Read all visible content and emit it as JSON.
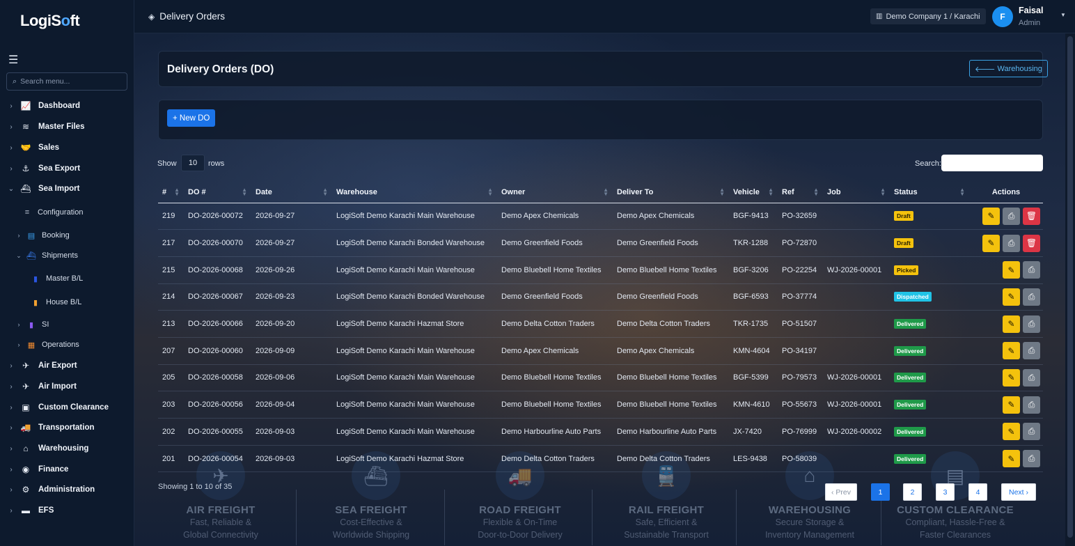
{
  "app": {
    "logo_main": "LogiS",
    "logo_accent": "o",
    "logo_end": "ft"
  },
  "sidebar": {
    "search_placeholder": "Search menu...",
    "items": [
      {
        "label": "Dashboard",
        "icon": "chart-line-icon"
      },
      {
        "label": "Master Files",
        "icon": "database-icon"
      },
      {
        "label": "Sales",
        "icon": "handshake-icon"
      },
      {
        "label": "Sea Export",
        "icon": "anchor-icon"
      },
      {
        "label": "Sea Import",
        "icon": "ship-icon"
      },
      {
        "label": "Air Export",
        "icon": "plane-icon"
      },
      {
        "label": "Air Import",
        "icon": "plane-arrival-icon"
      },
      {
        "label": "Custom Clearance",
        "icon": "customs-icon"
      },
      {
        "label": "Transportation",
        "icon": "truck-icon"
      },
      {
        "label": "Warehousing",
        "icon": "warehouse-icon"
      },
      {
        "label": "Finance",
        "icon": "coins-icon"
      },
      {
        "label": "Administration",
        "icon": "gear-icon"
      },
      {
        "label": "EFS",
        "icon": "folder-icon"
      }
    ],
    "sea_import_children": {
      "configuration": "Configuration",
      "booking": "Booking",
      "shipments": "Shipments",
      "master_bl": "Master B/L",
      "house_bl": "House B/L",
      "si": "SI",
      "operations": "Operations"
    }
  },
  "topbar": {
    "title": "Delivery Orders",
    "company": "Demo Company 1 / Karachi",
    "avatar_initial": "F",
    "user_name": "Faisal",
    "user_role": "Admin"
  },
  "page": {
    "title": "Delivery Orders (DO)",
    "back_button": "Warehousing",
    "new_button": "+ New DO",
    "show_label": "Show",
    "rows_value": "10",
    "rows_label": "rows",
    "search_label": "Search:",
    "showing_text": "Showing 1 to 10 of 35"
  },
  "table": {
    "columns": [
      "#",
      "DO #",
      "Date",
      "Warehouse",
      "Owner",
      "Deliver To",
      "Vehicle",
      "Ref",
      "Job",
      "Status",
      "Actions"
    ],
    "rows": [
      {
        "id": "219",
        "do": "DO-2026-00072",
        "date": "2026-09-27",
        "warehouse": "LogiSoft Demo Karachi Main Warehouse",
        "owner": "Demo Apex Chemicals",
        "deliver_to": "Demo Apex Chemicals",
        "vehicle": "BGF-9413",
        "ref": "PO-32659",
        "job": "",
        "status": "Draft",
        "status_kind": "draft",
        "can_delete": true
      },
      {
        "id": "217",
        "do": "DO-2026-00070",
        "date": "2026-09-27",
        "warehouse": "LogiSoft Demo Karachi Bonded Warehouse",
        "owner": "Demo Greenfield Foods",
        "deliver_to": "Demo Greenfield Foods",
        "vehicle": "TKR-1288",
        "ref": "PO-72870",
        "job": "",
        "status": "Draft",
        "status_kind": "draft",
        "can_delete": true
      },
      {
        "id": "215",
        "do": "DO-2026-00068",
        "date": "2026-09-26",
        "warehouse": "LogiSoft Demo Karachi Main Warehouse",
        "owner": "Demo Bluebell Home Textiles",
        "deliver_to": "Demo Bluebell Home Textiles",
        "vehicle": "BGF-3206",
        "ref": "PO-22254",
        "job": "WJ-2026-00001",
        "status": "Picked",
        "status_kind": "picked",
        "can_delete": false
      },
      {
        "id": "214",
        "do": "DO-2026-00067",
        "date": "2026-09-23",
        "warehouse": "LogiSoft Demo Karachi Bonded Warehouse",
        "owner": "Demo Greenfield Foods",
        "deliver_to": "Demo Greenfield Foods",
        "vehicle": "BGF-6593",
        "ref": "PO-37774",
        "job": "",
        "status": "Dispatched",
        "status_kind": "dispatched",
        "can_delete": false
      },
      {
        "id": "213",
        "do": "DO-2026-00066",
        "date": "2026-09-20",
        "warehouse": "LogiSoft Demo Karachi Hazmat Store",
        "owner": "Demo Delta Cotton Traders",
        "deliver_to": "Demo Delta Cotton Traders",
        "vehicle": "TKR-1735",
        "ref": "PO-51507",
        "job": "",
        "status": "Delivered",
        "status_kind": "delivered",
        "can_delete": false
      },
      {
        "id": "207",
        "do": "DO-2026-00060",
        "date": "2026-09-09",
        "warehouse": "LogiSoft Demo Karachi Main Warehouse",
        "owner": "Demo Apex Chemicals",
        "deliver_to": "Demo Apex Chemicals",
        "vehicle": "KMN-4604",
        "ref": "PO-34197",
        "job": "",
        "status": "Delivered",
        "status_kind": "delivered",
        "can_delete": false
      },
      {
        "id": "205",
        "do": "DO-2026-00058",
        "date": "2026-09-06",
        "warehouse": "LogiSoft Demo Karachi Main Warehouse",
        "owner": "Demo Bluebell Home Textiles",
        "deliver_to": "Demo Bluebell Home Textiles",
        "vehicle": "BGF-5399",
        "ref": "PO-79573",
        "job": "WJ-2026-00001",
        "status": "Delivered",
        "status_kind": "delivered",
        "can_delete": false
      },
      {
        "id": "203",
        "do": "DO-2026-00056",
        "date": "2026-09-04",
        "warehouse": "LogiSoft Demo Karachi Main Warehouse",
        "owner": "Demo Bluebell Home Textiles",
        "deliver_to": "Demo Bluebell Home Textiles",
        "vehicle": "KMN-4610",
        "ref": "PO-55673",
        "job": "WJ-2026-00001",
        "status": "Delivered",
        "status_kind": "delivered",
        "can_delete": false
      },
      {
        "id": "202",
        "do": "DO-2026-00055",
        "date": "2026-09-03",
        "warehouse": "LogiSoft Demo Karachi Main Warehouse",
        "owner": "Demo Harbourline Auto Parts",
        "deliver_to": "Demo Harbourline Auto Parts",
        "vehicle": "JX-7420",
        "ref": "PO-76999",
        "job": "WJ-2026-00002",
        "status": "Delivered",
        "status_kind": "delivered",
        "can_delete": false
      },
      {
        "id": "201",
        "do": "DO-2026-00054",
        "date": "2026-09-03",
        "warehouse": "LogiSoft Demo Karachi Hazmat Store",
        "owner": "Demo Delta Cotton Traders",
        "deliver_to": "Demo Delta Cotton Traders",
        "vehicle": "LES-9438",
        "ref": "PO-58039",
        "job": "",
        "status": "Delivered",
        "status_kind": "delivered",
        "can_delete": false
      }
    ]
  },
  "pagination": {
    "prev": "‹ Prev",
    "pages": [
      "1",
      "2",
      "3",
      "4"
    ],
    "active": "1",
    "next": "Next ›"
  },
  "background_banners": [
    {
      "title": "AIR FREIGHT",
      "line1": "Fast, Reliable &",
      "line2": "Global Connectivity"
    },
    {
      "title": "SEA FREIGHT",
      "line1": "Cost-Effective &",
      "line2": "Worldwide Shipping"
    },
    {
      "title": "ROAD FREIGHT",
      "line1": "Flexible & On-Time",
      "line2": "Door-to-Door Delivery"
    },
    {
      "title": "RAIL FREIGHT",
      "line1": "Safe, Efficient &",
      "line2": "Sustainable Transport"
    },
    {
      "title": "WAREHOUSING",
      "line1": "Secure Storage &",
      "line2": "Inventory Management"
    },
    {
      "title": "CUSTOM CLEARANCE",
      "line1": "Compliant, Hassle-Free &",
      "line2": "Faster Clearances"
    }
  ],
  "colors": {
    "primary": "#1b73e8",
    "warning": "#f4c20d",
    "danger": "#dc3545",
    "success": "#1f9a49",
    "info": "#20c3e6"
  }
}
